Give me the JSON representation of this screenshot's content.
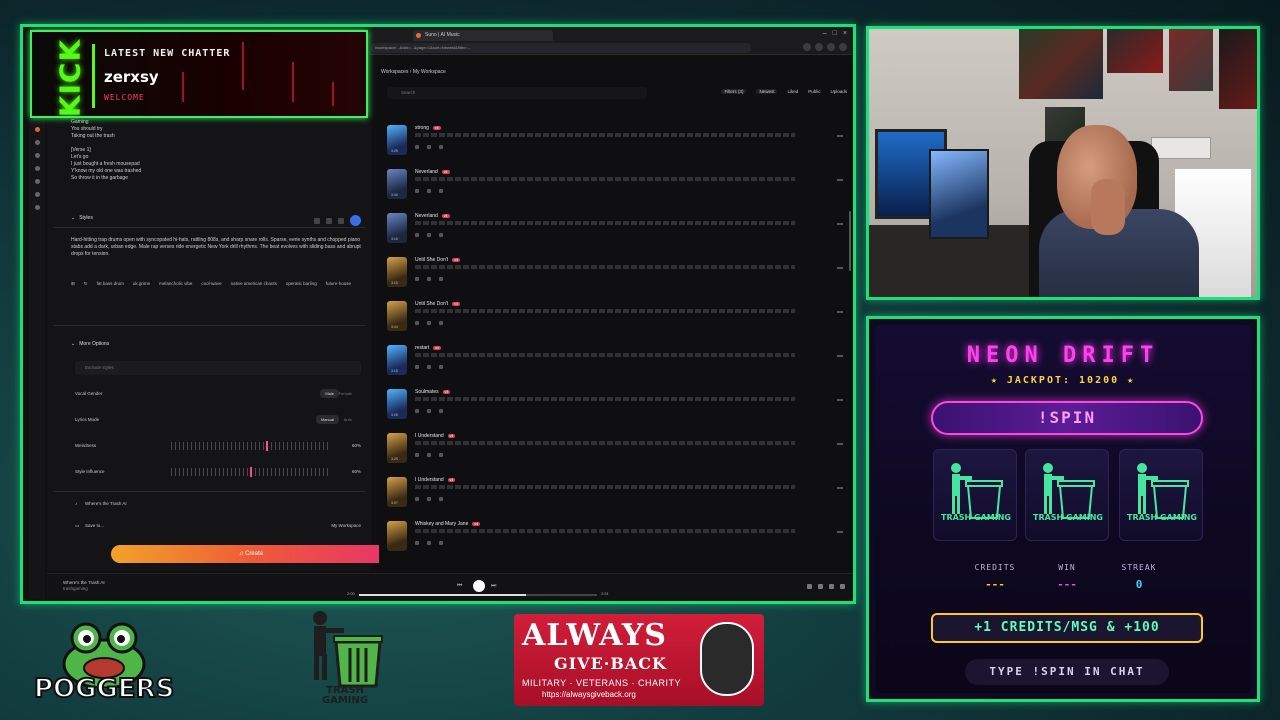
{
  "browser": {
    "tab_title": "Suno | AI Music",
    "url": "/workspace/...&wid=...&page=1&sort=Newest&filter=..."
  },
  "chatter": {
    "platform": "KICK",
    "label": "LATEST NEW CHATTER",
    "name": "zerxsy",
    "welcome": "WELCOME"
  },
  "suno": {
    "lyrics": [
      "Gaming",
      "You should try",
      "Taking out the trash",
      "",
      "[Verse 1]",
      "Let's go",
      "I just bought a fresh mousepad",
      "Y'know my old one was trashed",
      "So throw it in the garbage"
    ],
    "styles_header": "Styles",
    "styles_desc": "Hard-hitting trap drums open with syncopated hi-hats, rattling 808s, and sharp snare rolls. Sparse, eerie synths and chopped piano stabs add a dark, urban edge. Male rap verses ride energetic New York drill rhythms. The beat evolves with sliding bass and abrupt drops for tension.",
    "style_tags": [
      "fat bass drum",
      "uk grime",
      "melancholic vibe",
      "cool-wave",
      "native american chants",
      "operatic barling",
      "future-house"
    ],
    "more_options": "More Options",
    "exclude_placeholder": "Exclude styles",
    "vocal_gender": {
      "label": "Vocal Gender",
      "opt1": "Male",
      "opt2": "Female"
    },
    "lyrics_mode": {
      "label": "Lyrics Mode",
      "opt1": "Manual",
      "opt2": "Auto"
    },
    "weirdness": {
      "label": "Weirdness",
      "value": "60%",
      "level": 0.6
    },
    "style_influence": {
      "label": "Style Influence",
      "value": "60%",
      "level": 0.5
    },
    "song_title": "Where's the Trash AI",
    "save_to": {
      "label": "Save to...",
      "value": "My Workspace"
    },
    "create_label": "Create",
    "now_playing": {
      "title": "Where's the Trash AI",
      "artist": "trashgaming"
    }
  },
  "workspace": {
    "crumb": "Workspaces  ›  My Workspace",
    "search_placeholder": "Search",
    "filters": [
      "Filters (3)",
      "Newest",
      "Liked",
      "Public",
      "Uploads"
    ],
    "songs": [
      {
        "title": "strong",
        "dur": "3:25",
        "art": "blue"
      },
      {
        "title": "Neverland",
        "dur": "3:46",
        "art": "default"
      },
      {
        "title": "Neverland",
        "dur": "3:18",
        "art": "default"
      },
      {
        "title": "Until She Don't",
        "dur": "3:15",
        "art": "gold"
      },
      {
        "title": "Until She Don't",
        "dur": "3:44",
        "art": "gold"
      },
      {
        "title": "restart",
        "dur": "3:18",
        "art": "blue"
      },
      {
        "title": "Soulmates",
        "dur": "3:28",
        "art": "blue"
      },
      {
        "title": "I Understand",
        "dur": "3:29",
        "art": "gold"
      },
      {
        "title": "I Understand",
        "dur": "3:07",
        "art": "gold"
      },
      {
        "title": "Whiskey and Mary Jane",
        "dur": "",
        "art": "gold"
      }
    ]
  },
  "player": {
    "elapsed": "2:00",
    "total": "2:51",
    "progress": 0.7
  },
  "slot": {
    "title": "NEON DRIFT",
    "jackpot": "★ JACKPOT: 10200 ★",
    "spin": "!SPIN",
    "reels": [
      "TRASH GAMING",
      "TRASH GAMING",
      "TRASH GAMING"
    ],
    "stats": [
      {
        "label": "CREDITS",
        "value": "---",
        "color": "#ffc62e"
      },
      {
        "label": "WIN",
        "value": "---",
        "color": "#ff45e6"
      },
      {
        "label": "STREAK",
        "value": "0",
        "color": "#3fd2ff"
      }
    ],
    "credits_banner": "+1 CREDITS/MSG & +100",
    "hint": "TYPE !SPIN IN CHAT"
  },
  "logos": {
    "poggers": "POGGERS",
    "trash_line1": "TRASH",
    "trash_line2": "GAMING",
    "agb_line1": "ALWAYS",
    "agb_line2": "GIVE·BACK",
    "agb_line3": "MILITARY · VETERANS · CHARITY",
    "agb_url": "https://alwaysgiveback.org"
  },
  "colors": {
    "frame": "#1ee07a",
    "kick": "#53fc18",
    "neon_pink": "#ff3ff0",
    "gold": "#ffc62e"
  }
}
